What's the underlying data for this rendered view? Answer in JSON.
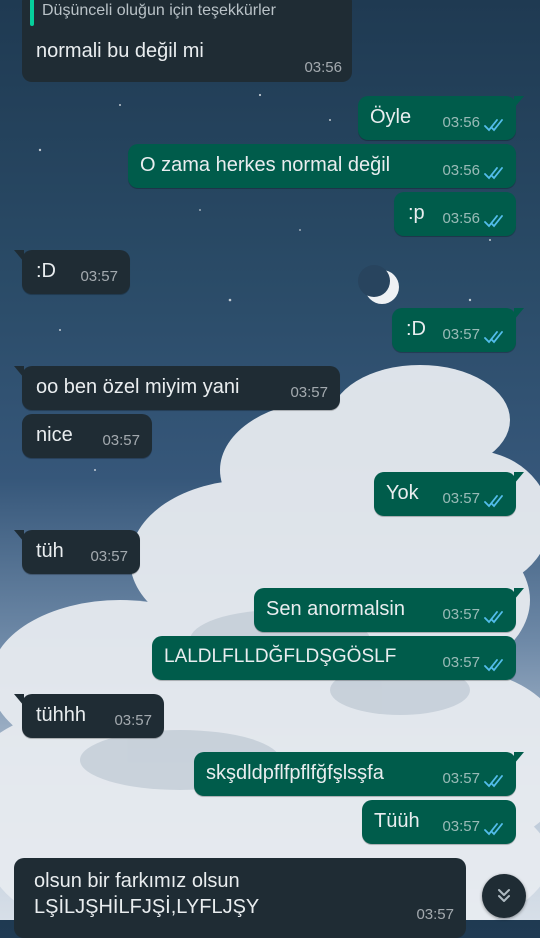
{
  "chat": {
    "quoted": {
      "text": "Düşünceli oluğun için teşekkürler",
      "accent": "#06cf9c"
    },
    "messages": [
      {
        "dir": "in",
        "text": "normali bu değil mi",
        "time": "03:56"
      },
      {
        "dir": "out",
        "text": "Öyle",
        "time": "03:56"
      },
      {
        "dir": "out",
        "text": "O zama herkes normal değil",
        "time": "03:56"
      },
      {
        "dir": "out",
        "text": ":p",
        "time": "03:56"
      },
      {
        "dir": "in",
        "text": ":D",
        "time": "03:57"
      },
      {
        "dir": "out",
        "text": ":D",
        "time": "03:57"
      },
      {
        "dir": "in",
        "text": "oo ben özel miyim yani",
        "time": "03:57"
      },
      {
        "dir": "in",
        "text": "nice",
        "time": "03:57"
      },
      {
        "dir": "out",
        "text": "Yok",
        "time": "03:57"
      },
      {
        "dir": "in",
        "text": "tüh",
        "time": "03:57"
      },
      {
        "dir": "out",
        "text": "Sen anormalsin",
        "time": "03:57"
      },
      {
        "dir": "out",
        "text": "LALDLFLLDĞFLDŞGÖSLF",
        "time": "03:57"
      },
      {
        "dir": "in",
        "text": "tühhh",
        "time": "03:57"
      },
      {
        "dir": "out",
        "text": "skşdldpflfpflfğfşlsşfa",
        "time": "03:57"
      },
      {
        "dir": "out",
        "text": "Tüüh",
        "time": "03:57"
      }
    ],
    "last_message": {
      "line1": "olsun bir farkımız olsun",
      "line2": "LŞİLJŞHİLFJŞİ,LYFLJŞY",
      "time": "03:57"
    }
  },
  "colors": {
    "incoming_bubble": "#1f2c34",
    "outgoing_bubble": "#005c4b",
    "read_ticks": "#53bdeb"
  },
  "icons": {
    "read_receipt": "double-check-icon",
    "scroll_down": "chevrons-down-icon"
  }
}
